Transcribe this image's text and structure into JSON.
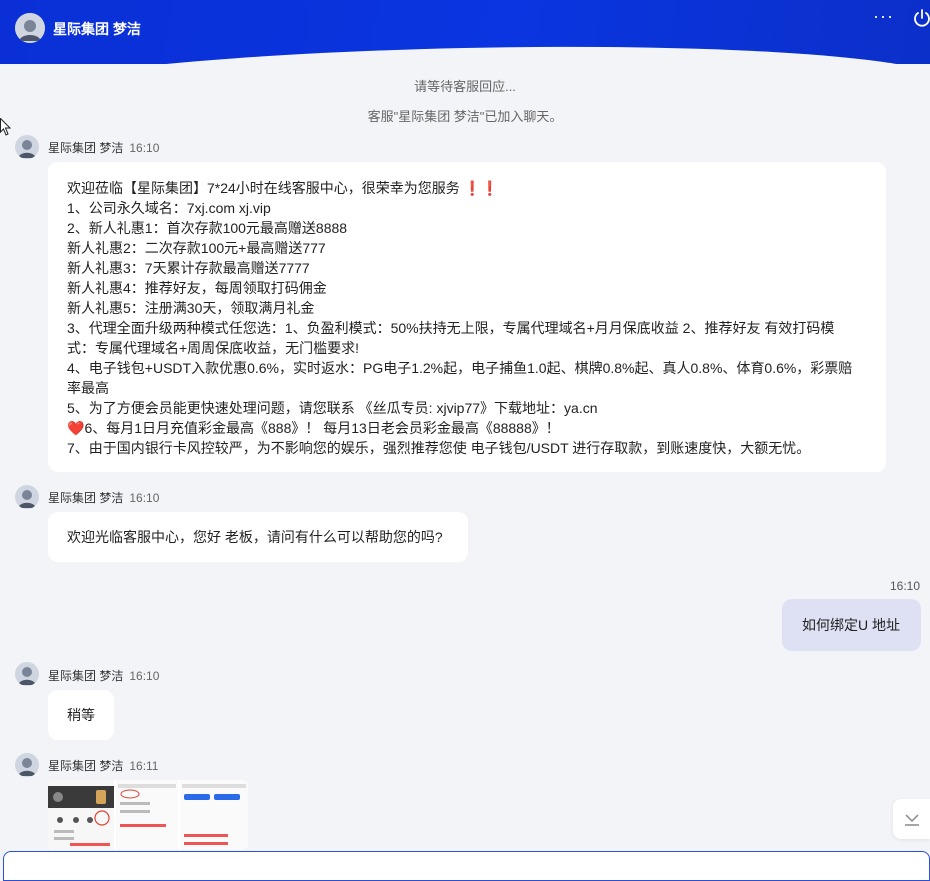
{
  "header": {
    "title": "星际集团 梦洁",
    "more_icon": "more-horizontal-icon",
    "power_icon": "power-icon",
    "more_label": "···"
  },
  "system": {
    "waiting": "请等待客服回应...",
    "joined": "客服\"星际集团 梦洁\"已加入聊天。"
  },
  "messages": [
    {
      "sender": "星际集团 梦洁",
      "time": "16:10",
      "lines": [
        "欢迎莅临【星际集团】7*24小时在线客服中心，很荣幸为您服务",
        "1、公司永久域名：7xj.com xj.vip",
        "2、新人礼惠1：首次存款100元最高赠送8888",
        "新人礼惠2：二次存款100元+最高赠送777",
        "新人礼惠3：7天累计存款最高赠送7777",
        "新人礼惠4：推荐好友，每周领取打码佣金",
        "新人礼惠5：注册满30天，领取满月礼金",
        "3、代理全面升级两种模式任您选：1、负盈利模式：50%扶持无上限，专属代理域名+月月保底收益 2、推荐好友 有效打码模",
        "式：专属代理域名+周周保底收益，无门槛要求!",
        "4、电子钱包+USDT入款优惠0.6%，实时返水：PG电子1.2%起，电子捕鱼1.0起、棋牌0.8%起、真人0.8%、体育0.6%，彩票赔",
        "率最高",
        "5、为了方便会员能更快速处理问题，请您联系 《丝瓜专员: xjvip77》下载地址：ya.cn",
        "6、每月1日月充值彩金最高《888》！ 每月13日老会员彩金最高《88888》！",
        "7、由于国内银行卡风控较严，为不影响您的娱乐，强烈推荐您使 电子钱包/USDT 进行存取款，到账速度快，大额无忧。"
      ],
      "emphasis": "❗❗",
      "heart": "❤️"
    },
    {
      "sender": "星际集团 梦洁",
      "time": "16:10",
      "text": "欢迎光临客服中心，您好 老板，请问有什么可以帮助您的吗?"
    },
    {
      "sender": "user",
      "time": "16:10",
      "text": "如何绑定U 地址"
    },
    {
      "sender": "星际集团 梦洁",
      "time": "16:10",
      "text": "稍等"
    },
    {
      "sender": "星际集团 梦洁",
      "time": "16:11",
      "attachment": "image-thumbnails"
    }
  ],
  "colors": {
    "header": "#0a35e0",
    "user_bubble": "#dde1f3",
    "accent_red": "#d6191f",
    "background": "#f3f4f8"
  }
}
